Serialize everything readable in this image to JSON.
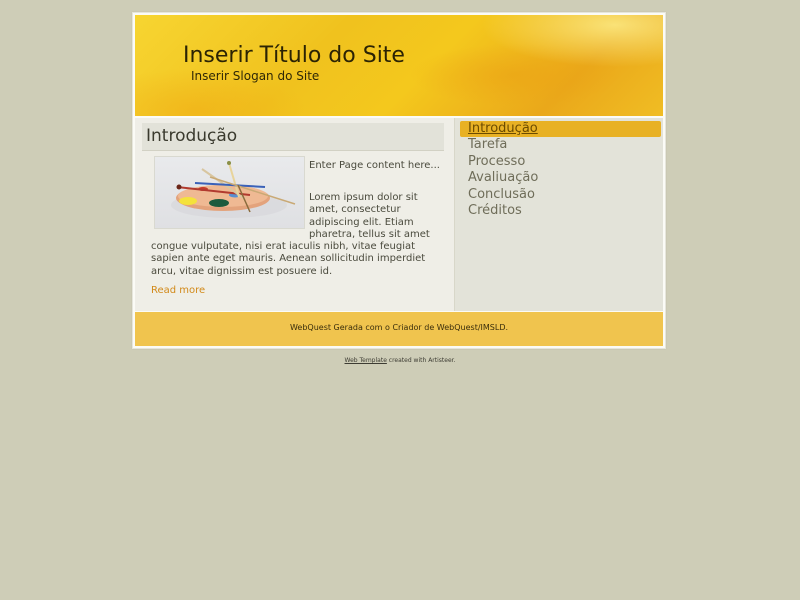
{
  "header": {
    "site_title": "Inserir Título do Site",
    "site_slogan": "Inserir Slogan do Site"
  },
  "post": {
    "title": "Introdução",
    "image_icon": "paint-palette-image",
    "intro": "Enter Page content here...",
    "body_top": "Lorem ipsum dolor sit amet, consectetur adipiscing elit. Etiam pharetra, tellus sit amet",
    "body_bottom": "congue vulputate, nisi erat iaculis nibh, vitae feugiat sapien ante eget mauris. Aenean sollicitudin imperdiet arcu, vitae dignissim est posuere id.",
    "read_more": "Read more"
  },
  "sidebar": {
    "items": [
      {
        "label": "Introdução",
        "active": true
      },
      {
        "label": "Tarefa",
        "active": false
      },
      {
        "label": "Processo",
        "active": false
      },
      {
        "label": "Avaliuação",
        "active": false
      },
      {
        "label": "Conclusão",
        "active": false
      },
      {
        "label": "Créditos",
        "active": false
      }
    ]
  },
  "footer": {
    "text": "WebQuest Gerada com o Criador de WebQuest/IMSLD."
  },
  "credits": {
    "link": "Web Template",
    "suffix": " created with Artisteer."
  },
  "colors": {
    "background": "#cecdb7",
    "header_yellow": "#f0c21e",
    "active_nav": "#e8b124",
    "footer": "#f0c44e",
    "link_orange": "#d28a1a"
  }
}
